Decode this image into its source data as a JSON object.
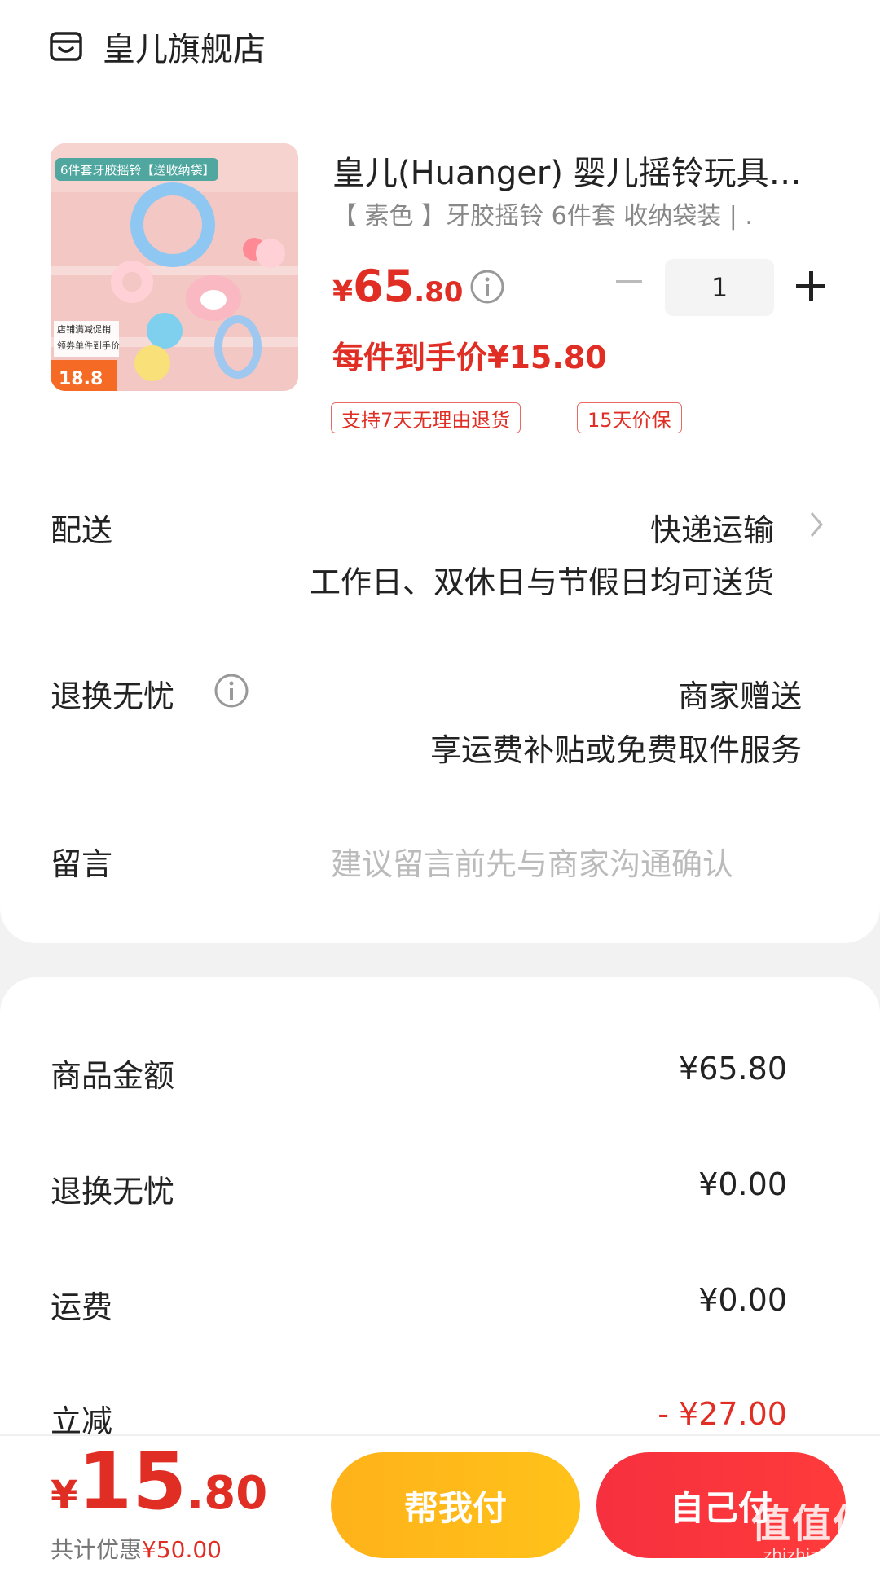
{
  "store": {
    "name": "皇儿旗舰店",
    "icon": "store-icon"
  },
  "product": {
    "title": "皇儿(Huanger) 婴儿摇铃玩具…",
    "sku": "【 素色 】牙胶摇铃 6件套 收纳袋装 | .",
    "price_currency": "¥",
    "price_int": "65",
    "price_dec": ".80",
    "quantity": "1",
    "unit_price": "每件到手价¥15.80",
    "tags": [
      "支持7天无理由退货",
      "15天价保"
    ],
    "thumbnail_text": {
      "banner": "6件套牙胶摇铃【送收纳袋】",
      "promo1": "店铺满减促销",
      "promo2": "领券单件到手价",
      "price": "18.8"
    }
  },
  "delivery": {
    "label": "配送",
    "value": "快递运输",
    "sub": "工作日、双休日与节假日均可送货"
  },
  "returns": {
    "label": "退换无忧",
    "value": "商家赠送",
    "sub": "享运费补贴或免费取件服务"
  },
  "message": {
    "label": "留言",
    "placeholder": "建议留言前先与商家沟通确认"
  },
  "summary": {
    "rows": [
      {
        "label": "商品金额",
        "value": "¥65.80"
      },
      {
        "label": "退换无忧",
        "value": "¥0.00"
      },
      {
        "label": "运费",
        "value": "¥0.00"
      },
      {
        "label": "立减",
        "value": "- ¥27.00"
      }
    ]
  },
  "footer": {
    "total_currency": "¥",
    "total_int": "15",
    "total_dec": ".80",
    "discount_label": "共计优惠",
    "discount_value": "¥50.00",
    "help_pay_label": "帮我付",
    "self_pay_label": "自己付",
    "watermark_main": "值值值",
    "watermark_url": "zhizhizhi.com"
  },
  "colors": {
    "accent": "#e02e24",
    "help_button": "#ffb21a",
    "self_button": "#f6303e"
  }
}
